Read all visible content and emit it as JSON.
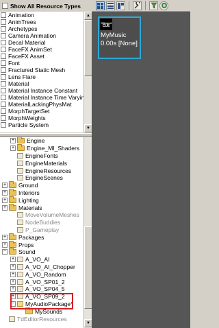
{
  "types_panel": {
    "show_all_label": "Show All Resource Types",
    "items": [
      "Animation",
      "AnimTrees",
      "Archetypes",
      "Camera Animation",
      "Decal Material",
      "FaceFX AnimSet",
      "FaceFX Asset",
      "Font",
      "Fractured Static Mesh",
      "Lens Flare",
      "Material",
      "Material Instance Constant",
      "Material Instance Time Varying",
      "MaterialLackingPhysMat",
      "MorphTargetSet",
      "MorphWeights",
      "Particle System"
    ]
  },
  "package_tree": {
    "nodes": [
      {
        "label": "Engine",
        "indent": 1,
        "expander": "+",
        "icon": "folder",
        "dim": false
      },
      {
        "label": "Engine_MI_Shaders",
        "indent": 1,
        "expander": "+",
        "icon": "folder",
        "dim": false
      },
      {
        "label": "EngineFonts",
        "indent": 1,
        "expander": "",
        "icon": "pkg",
        "dim": false
      },
      {
        "label": "EngineMaterials",
        "indent": 1,
        "expander": "",
        "icon": "pkg",
        "dim": false
      },
      {
        "label": "EngineResources",
        "indent": 1,
        "expander": "",
        "icon": "pkg",
        "dim": false
      },
      {
        "label": "EngineScenes",
        "indent": 1,
        "expander": "",
        "icon": "pkg",
        "dim": false
      },
      {
        "label": "Ground",
        "indent": 0,
        "expander": "+",
        "icon": "folder",
        "dim": false
      },
      {
        "label": "Interiors",
        "indent": 0,
        "expander": "+",
        "icon": "folder",
        "dim": false
      },
      {
        "label": "Lighting",
        "indent": 0,
        "expander": "+",
        "icon": "folder",
        "dim": false
      },
      {
        "label": "Materials",
        "indent": 0,
        "expander": "+",
        "icon": "folder",
        "dim": false
      },
      {
        "label": "MoveVolumeMeshes",
        "indent": 1,
        "expander": "",
        "icon": "pkg",
        "dim": true
      },
      {
        "label": "NodeBuddies",
        "indent": 1,
        "expander": "",
        "icon": "pkg",
        "dim": true
      },
      {
        "label": "P_Gameplay",
        "indent": 1,
        "expander": "",
        "icon": "pkg",
        "dim": true
      },
      {
        "label": "Packages",
        "indent": 0,
        "expander": "+",
        "icon": "folder",
        "dim": false
      },
      {
        "label": "Props",
        "indent": 0,
        "expander": "+",
        "icon": "folder",
        "dim": false
      },
      {
        "label": "Sound",
        "indent": 0,
        "expander": "-",
        "icon": "folder",
        "dim": false
      },
      {
        "label": "A_VO_AI",
        "indent": 1,
        "expander": "+",
        "icon": "pkg",
        "dim": false
      },
      {
        "label": "A_VO_AI_Chopper",
        "indent": 1,
        "expander": "+",
        "icon": "pkg",
        "dim": false
      },
      {
        "label": "A_VO_Random",
        "indent": 1,
        "expander": "+",
        "icon": "pkg",
        "dim": false
      },
      {
        "label": "A_VO_SP01_2",
        "indent": 1,
        "expander": "+",
        "icon": "pkg",
        "dim": false
      },
      {
        "label": "A_VO_SP04_5",
        "indent": 1,
        "expander": "+",
        "icon": "pkg",
        "dim": false
      },
      {
        "label": "A_VO_SP09_2",
        "indent": 1,
        "expander": "+",
        "icon": "pkg",
        "dim": false
      },
      {
        "label": "MyAudioPackage*",
        "indent": 1,
        "expander": "-",
        "icon": "pkg-dirty",
        "dim": false
      },
      {
        "label": "MySounds",
        "indent": 2,
        "expander": "",
        "icon": "folder",
        "dim": false
      },
      {
        "label": "TdEditorResources",
        "indent": 0,
        "expander": "",
        "icon": "pkg",
        "dim": true
      }
    ]
  },
  "toolbar": {
    "buttons": [
      "grid-view-icon",
      "list-view-icon",
      "split-view-icon",
      "wrench-icon",
      "filter-icon",
      "sync-icon"
    ]
  },
  "asset": {
    "thumb_line1": "%Sound",
    "thumb_line2": "CUE",
    "name": "MyMusic",
    "info": "0.00s [None]"
  },
  "colors": {
    "selection_border": "#2ea8d8",
    "highlight_box": "#d51d22",
    "viewport_bg": "#565656"
  }
}
